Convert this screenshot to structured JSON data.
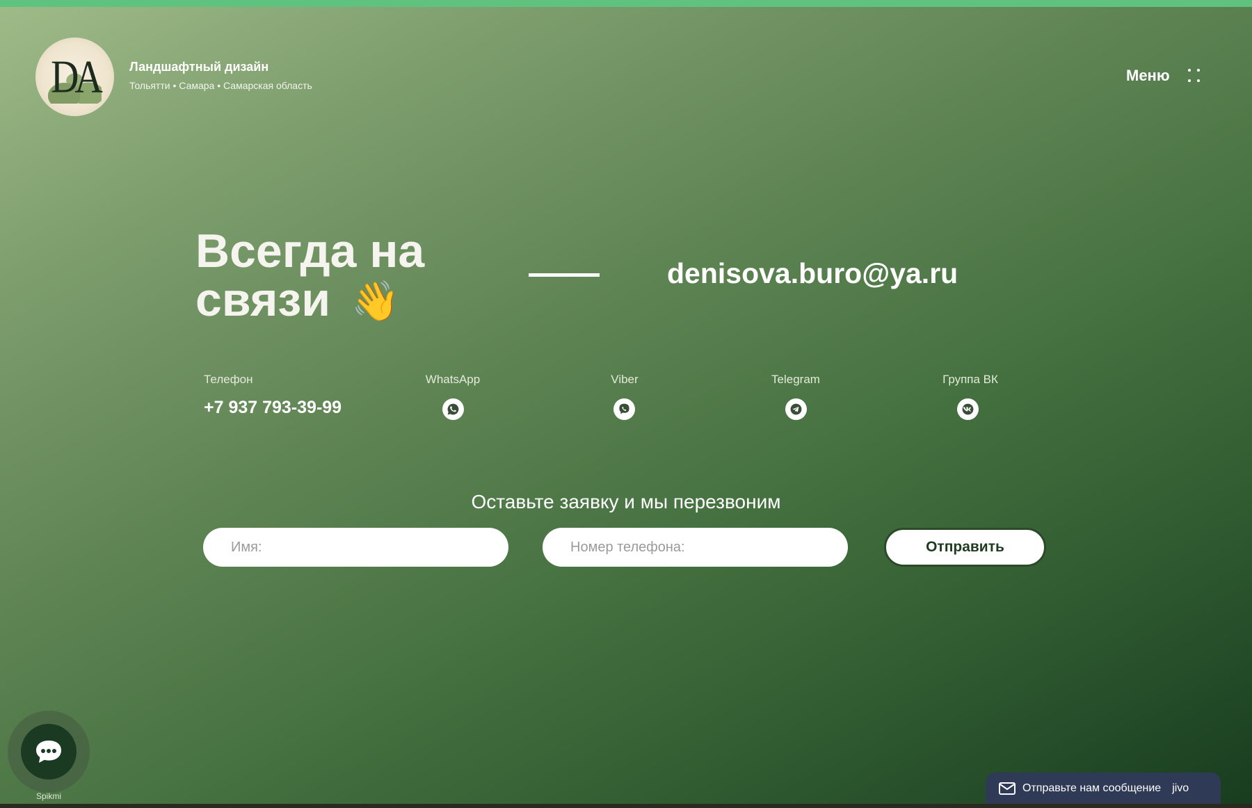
{
  "header": {
    "logo_text": "DA",
    "title": "Ландшафтный дизайн",
    "subtitle": "Тольятти • Самара • Самарская область",
    "menu_label": "Меню"
  },
  "hero": {
    "headline_line1": "Всегда на",
    "headline_line2": "связи",
    "wave_emoji": "👋",
    "email": "denisova.buro@ya.ru"
  },
  "contacts": {
    "phone": {
      "label": "Телефон",
      "value": "+7 937 793-39-99"
    },
    "whatsapp": {
      "label": "WhatsApp",
      "icon": "whatsapp-icon"
    },
    "viber": {
      "label": "Viber",
      "icon": "viber-icon"
    },
    "telegram": {
      "label": "Telegram",
      "icon": "telegram-icon"
    },
    "vk": {
      "label": "Группа ВК",
      "icon": "vk-icon"
    }
  },
  "form": {
    "title": "Оставьте заявку и мы перезвоним",
    "name_placeholder": "Имя:",
    "name_value": "",
    "phone_placeholder": "Номер телефона:",
    "phone_value": "",
    "submit_label": "Отправить"
  },
  "chat_widget": {
    "label": "Spikmi"
  },
  "jivo": {
    "text": "Отправьте нам сообщение",
    "brand": "jivo"
  },
  "colors": {
    "accent_line": "#5fc27e",
    "button_text": "#1e3b21",
    "jivo_bg": "#2f3a56"
  }
}
